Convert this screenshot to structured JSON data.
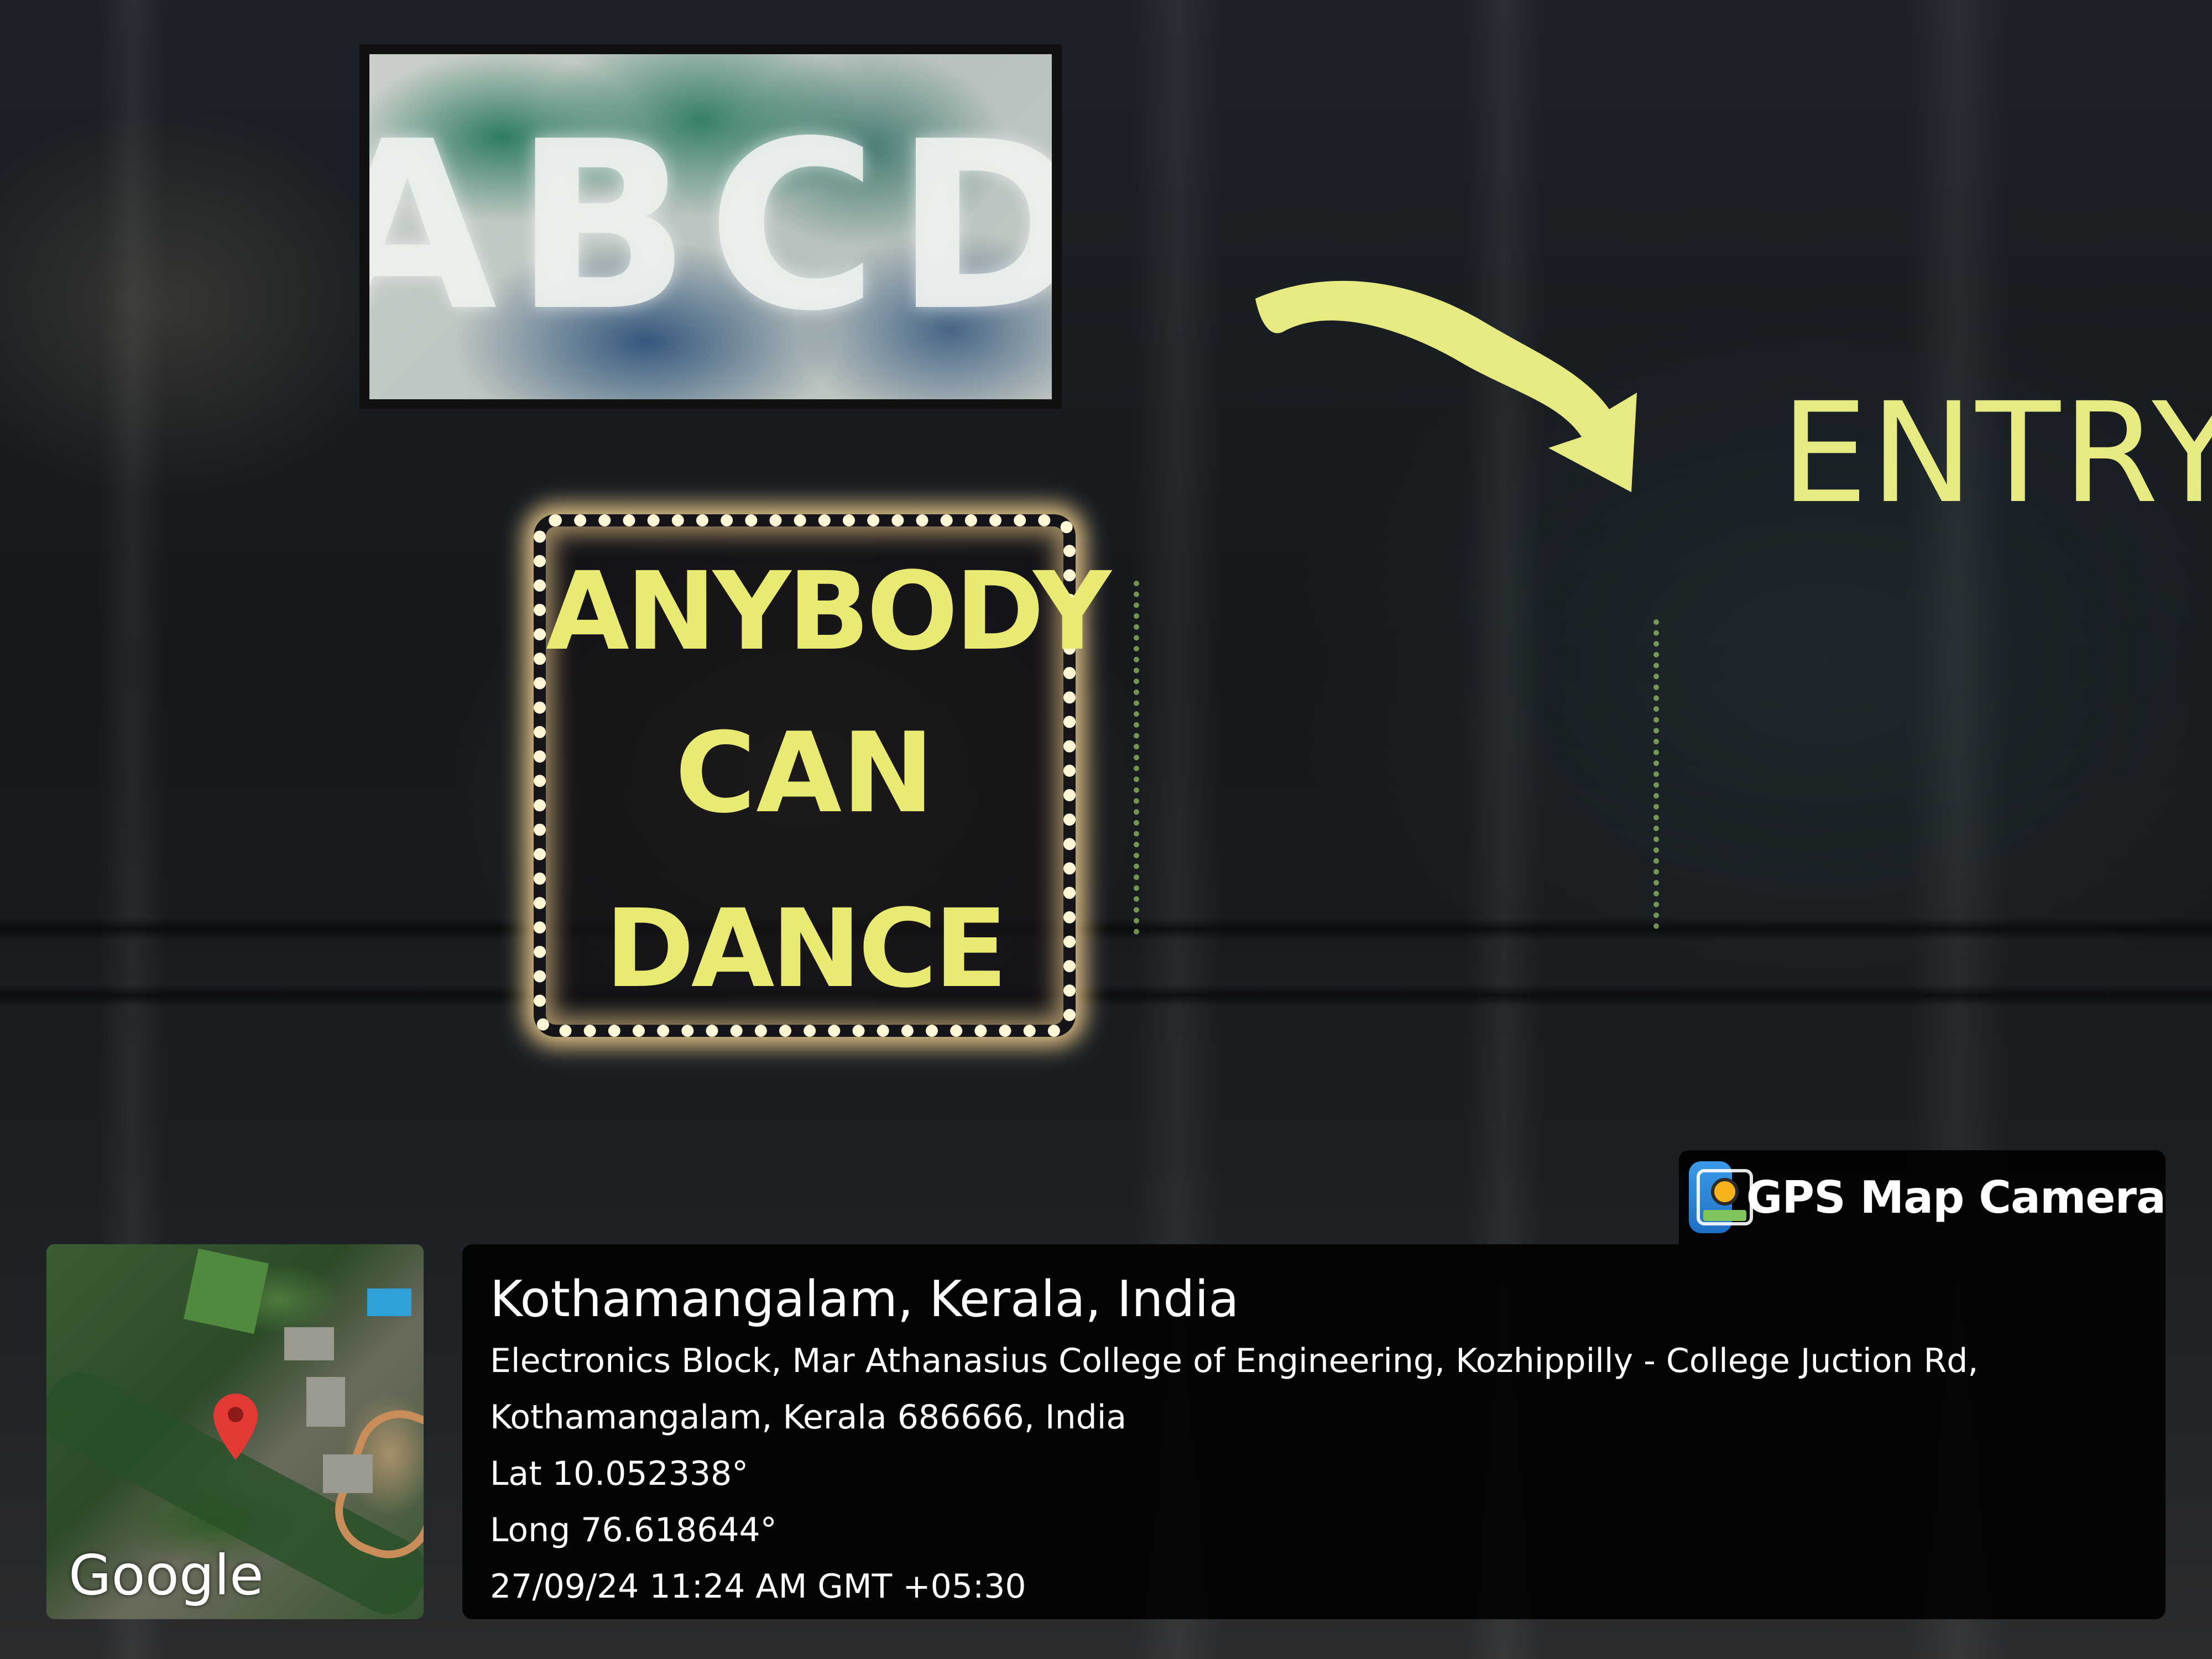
{
  "scene": {
    "board_text": "ABCD",
    "sign_lines": [
      "ANYBODY",
      "CAN",
      "DANCE"
    ],
    "entry_text": "ENTRY",
    "colors": {
      "sign_yellow": "#e8ea72",
      "led_glow": "#fff6d6",
      "tarp": "#1b1f23"
    }
  },
  "overlay": {
    "app_name": "GPS Map Camera",
    "app_icon": "gps-map-camera-icon",
    "location_title": "Kothamangalam, Kerala, India",
    "address_line1": "Electronics Block, Mar Athanasius College of Engineering, Kozhippilly - College Juction Rd,",
    "address_line2": "Kothamangalam, Kerala 686666, India",
    "lat": "Lat 10.052338°",
    "long": "Long 76.618644°",
    "datetime": "27/09/24 11:24 AM GMT +05:30",
    "map_logo": "Google",
    "map_pin_icon": "location-pin-icon"
  }
}
